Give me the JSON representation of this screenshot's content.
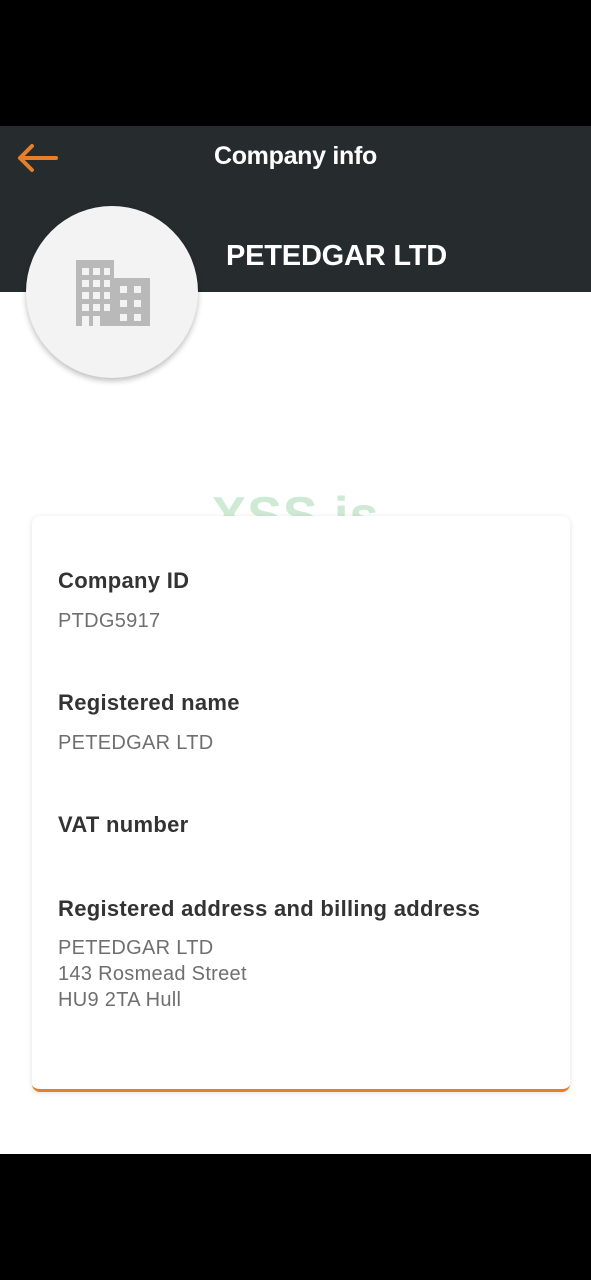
{
  "header": {
    "title": "Company info",
    "back_icon": "arrow-left-icon",
    "accent_color": "#e57f2b",
    "background_color": "#262b2e"
  },
  "company": {
    "name": "PETEDGAR LTD",
    "avatar_icon": "building-icon"
  },
  "watermark": "XSS.is",
  "details": {
    "company_id_label": "Company ID",
    "company_id_value": "PTDG5917",
    "registered_name_label": "Registered name",
    "registered_name_value": "PETEDGAR LTD",
    "vat_label": "VAT number",
    "address_label": "Registered address and billing address",
    "address_lines": [
      "PETEDGAR LTD",
      "143 Rosmead Street",
      "HU9 2TA Hull"
    ]
  }
}
